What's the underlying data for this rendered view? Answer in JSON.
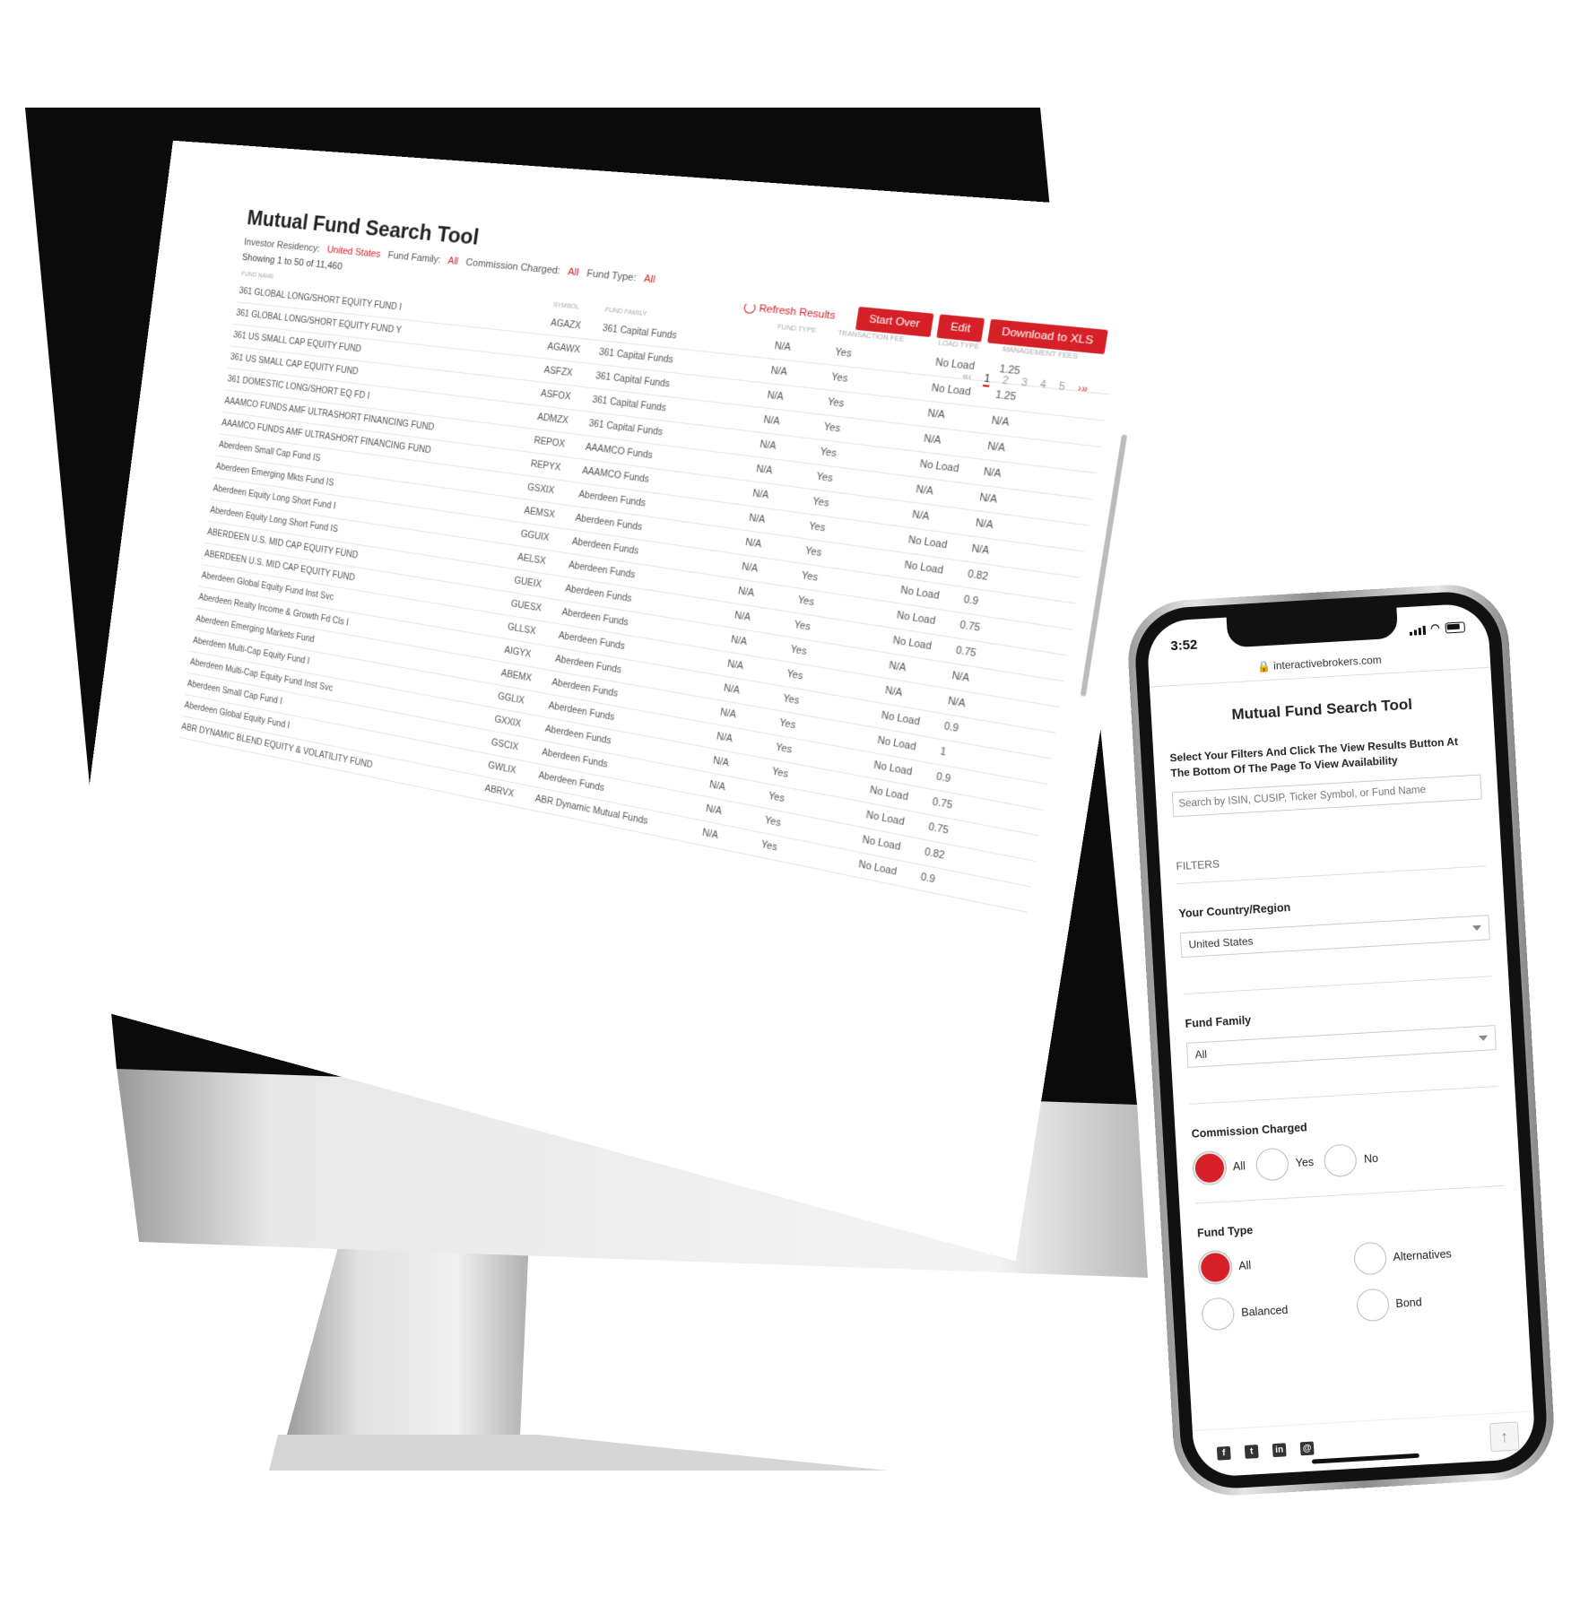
{
  "desktop": {
    "title": "Mutual Fund Search Tool",
    "meta": {
      "residency_label": "Investor Residency:",
      "residency_value": "United States",
      "family_label": "Fund Family:",
      "family_value": "All",
      "commission_label": "Commission Charged:",
      "commission_value": "All",
      "type_label": "Fund Type:",
      "type_value": "All"
    },
    "showing": "Showing 1 to 50 of 11,460",
    "refresh_label": "Refresh Results",
    "buttons": {
      "start_over": "Start Over",
      "edit": "Edit",
      "download": "Download to XLS"
    },
    "pager": {
      "prev": "«‹",
      "pages": [
        "1",
        "2",
        "3",
        "4",
        "5"
      ],
      "next": "›»"
    },
    "columns": [
      "Fund Name",
      "Symbol",
      "Fund Family",
      "Fund Type",
      "Transaction Fee",
      "Load Type",
      "Management Fees"
    ],
    "rows": [
      [
        "361 GLOBAL LONG/SHORT EQUITY FUND I",
        "AGAZX",
        "361 Capital Funds",
        "N/A",
        "Yes",
        "No Load",
        "1.25"
      ],
      [
        "361 GLOBAL LONG/SHORT EQUITY FUND Y",
        "AGAWX",
        "361 Capital Funds",
        "N/A",
        "Yes",
        "No Load",
        "1.25"
      ],
      [
        "361 US SMALL CAP EQUITY FUND",
        "ASFZX",
        "361 Capital Funds",
        "N/A",
        "Yes",
        "N/A",
        "N/A"
      ],
      [
        "361 US SMALL CAP EQUITY FUND",
        "ASFOX",
        "361 Capital Funds",
        "N/A",
        "Yes",
        "N/A",
        "N/A"
      ],
      [
        "361 DOMESTIC LONG/SHORT EQ FD I",
        "ADMZX",
        "361 Capital Funds",
        "N/A",
        "Yes",
        "No Load",
        "N/A"
      ],
      [
        "AAAMCO FUNDS AMF ULTRASHORT FINANCING FUND",
        "REPOX",
        "AAAMCO Funds",
        "N/A",
        "Yes",
        "N/A",
        "N/A"
      ],
      [
        "AAAMCO FUNDS AMF ULTRASHORT FINANCING FUND",
        "REPYX",
        "AAAMCO Funds",
        "N/A",
        "Yes",
        "N/A",
        "N/A"
      ],
      [
        "Aberdeen Small Cap Fund IS",
        "GSXIX",
        "Aberdeen Funds",
        "N/A",
        "Yes",
        "No Load",
        "N/A"
      ],
      [
        "Aberdeen Emerging Mkts Fund IS",
        "AEMSX",
        "Aberdeen Funds",
        "N/A",
        "Yes",
        "No Load",
        "0.82"
      ],
      [
        "Aberdeen Equity Long Short Fund I",
        "GGUIX",
        "Aberdeen Funds",
        "N/A",
        "Yes",
        "No Load",
        "0.9"
      ],
      [
        "Aberdeen Equity Long Short Fund IS",
        "AELSX",
        "Aberdeen Funds",
        "N/A",
        "Yes",
        "No Load",
        "0.75"
      ],
      [
        "ABERDEEN U.S. MID CAP EQUITY FUND",
        "GUEIX",
        "Aberdeen Funds",
        "N/A",
        "Yes",
        "No Load",
        "0.75"
      ],
      [
        "ABERDEEN U.S. MID CAP EQUITY FUND",
        "GUESX",
        "Aberdeen Funds",
        "N/A",
        "Yes",
        "N/A",
        "N/A"
      ],
      [
        "Aberdeen Global Equity Fund Inst Svc",
        "GLLSX",
        "Aberdeen Funds",
        "N/A",
        "Yes",
        "N/A",
        "N/A"
      ],
      [
        "Aberdeen Realty Income & Growth Fd Cls I",
        "AIGYX",
        "Aberdeen Funds",
        "N/A",
        "Yes",
        "No Load",
        "0.9"
      ],
      [
        "Aberdeen Emerging Markets Fund",
        "ABEMX",
        "Aberdeen Funds",
        "N/A",
        "Yes",
        "No Load",
        "1"
      ],
      [
        "Aberdeen Multi-Cap Equity Fund I",
        "GGLIX",
        "Aberdeen Funds",
        "N/A",
        "Yes",
        "No Load",
        "0.9"
      ],
      [
        "Aberdeen Multi-Cap Equity Fund Inst Svc",
        "GXXIX",
        "Aberdeen Funds",
        "N/A",
        "Yes",
        "No Load",
        "0.75"
      ],
      [
        "Aberdeen Small Cap Fund I",
        "GSCIX",
        "Aberdeen Funds",
        "N/A",
        "Yes",
        "No Load",
        "0.75"
      ],
      [
        "Aberdeen Global Equity Fund I",
        "GWLIX",
        "Aberdeen Funds",
        "N/A",
        "Yes",
        "No Load",
        "0.82"
      ],
      [
        "ABR DYNAMIC BLEND EQUITY & VOLATILITY FUND",
        "ABRVX",
        "ABR Dynamic Mutual Funds",
        "N/A",
        "Yes",
        "No Load",
        "0.9"
      ]
    ]
  },
  "phone": {
    "time": "3:52",
    "url": "interactivebrokers.com",
    "title": "Mutual Fund Search Tool",
    "instructions": "Select Your Filters And Click The View Results Button At The Bottom Of The Page To View Availability",
    "search_placeholder": "Search by ISIN, CUSIP, Ticker Symbol, or Fund Name",
    "filters_heading": "FILTERS",
    "country_label": "Your Country/Region",
    "country_value": "United States",
    "family_label": "Fund Family",
    "family_value": "All",
    "commission_label": "Commission Charged",
    "commission_options": [
      "All",
      "Yes",
      "No"
    ],
    "fund_type_label": "Fund Type",
    "fund_type_options": [
      "All",
      "Alternatives",
      "Balanced",
      "Bond"
    ]
  },
  "colors": {
    "accent": "#d62027"
  }
}
